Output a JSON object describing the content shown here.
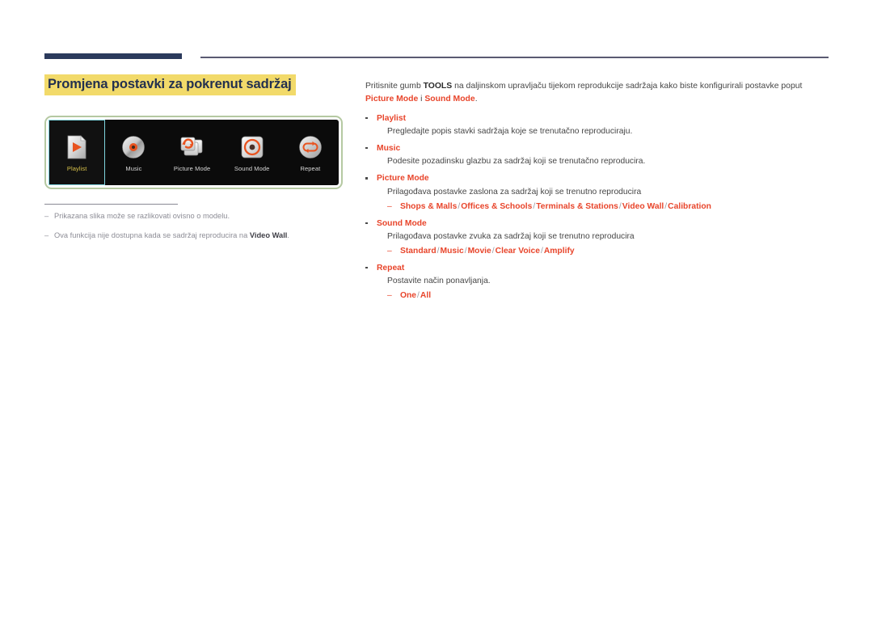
{
  "heading": "Promjena postavki za pokrenut sadržaj",
  "device_panel": {
    "tiles": [
      {
        "label": "Playlist",
        "icon": "playlist-page-play-icon",
        "selected": true
      },
      {
        "label": "Music",
        "icon": "music-disc-icon",
        "selected": false
      },
      {
        "label": "Picture Mode",
        "icon": "picture-mode-cards-icon",
        "selected": false
      },
      {
        "label": "Sound Mode",
        "icon": "sound-mode-speaker-icon",
        "selected": false
      },
      {
        "label": "Repeat",
        "icon": "repeat-loop-icon",
        "selected": false
      }
    ]
  },
  "notes": [
    {
      "dash": "‒",
      "text_before": "Prikazana slika može se razlikovati ovisno o modelu.",
      "bold": "",
      "text_after": ""
    },
    {
      "dash": "‒",
      "text_before": "Ova funkcija nije dostupna kada se sadržaj reproducira na ",
      "bold": "Video Wall",
      "text_after": "."
    }
  ],
  "intro": {
    "p1": "Pritisnite gumb ",
    "b1": "TOOLS",
    "p2": " na daljinskom upravljaču tijekom reprodukcije sadržaja kako biste konfigurirali postavke poput ",
    "b2": "Picture Mode",
    "p3": " i ",
    "b3": "Sound Mode",
    "p4": "."
  },
  "bullets": [
    {
      "title": "Playlist",
      "desc": "Pregledajte popis stavki sadržaja koje se trenutačno reproduciraju.",
      "options": []
    },
    {
      "title": "Music",
      "desc": "Podesite pozadinsku glazbu za sadržaj koji se trenutačno reproducira.",
      "options": []
    },
    {
      "title": "Picture Mode",
      "desc": "Prilagođava postavke zaslona za sadržaj koji se trenutno reproducira",
      "options": [
        "Shops & Malls",
        "Offices & Schools",
        "Terminals & Stations",
        "Video Wall",
        "Calibration"
      ]
    },
    {
      "title": "Sound Mode",
      "desc": "Prilagođava postavke zvuka za sadržaj koji se trenutno reproducira",
      "options": [
        "Standard",
        "Music",
        "Movie",
        "Clear Voice",
        "Amplify"
      ]
    },
    {
      "title": "Repeat",
      "desc": "Postavite način ponavljanja.",
      "options": [
        "One",
        "All"
      ]
    }
  ],
  "colors": {
    "accent_red": "#e8452b",
    "heading_highlight": "#f2da6a",
    "heading_text": "#23304f",
    "rule_navy": "#2b3a5c",
    "panel_border_green": "#b5c9a2",
    "selected_border_cyan": "#7fd4de",
    "selected_label_yellow": "#d8c24a"
  }
}
